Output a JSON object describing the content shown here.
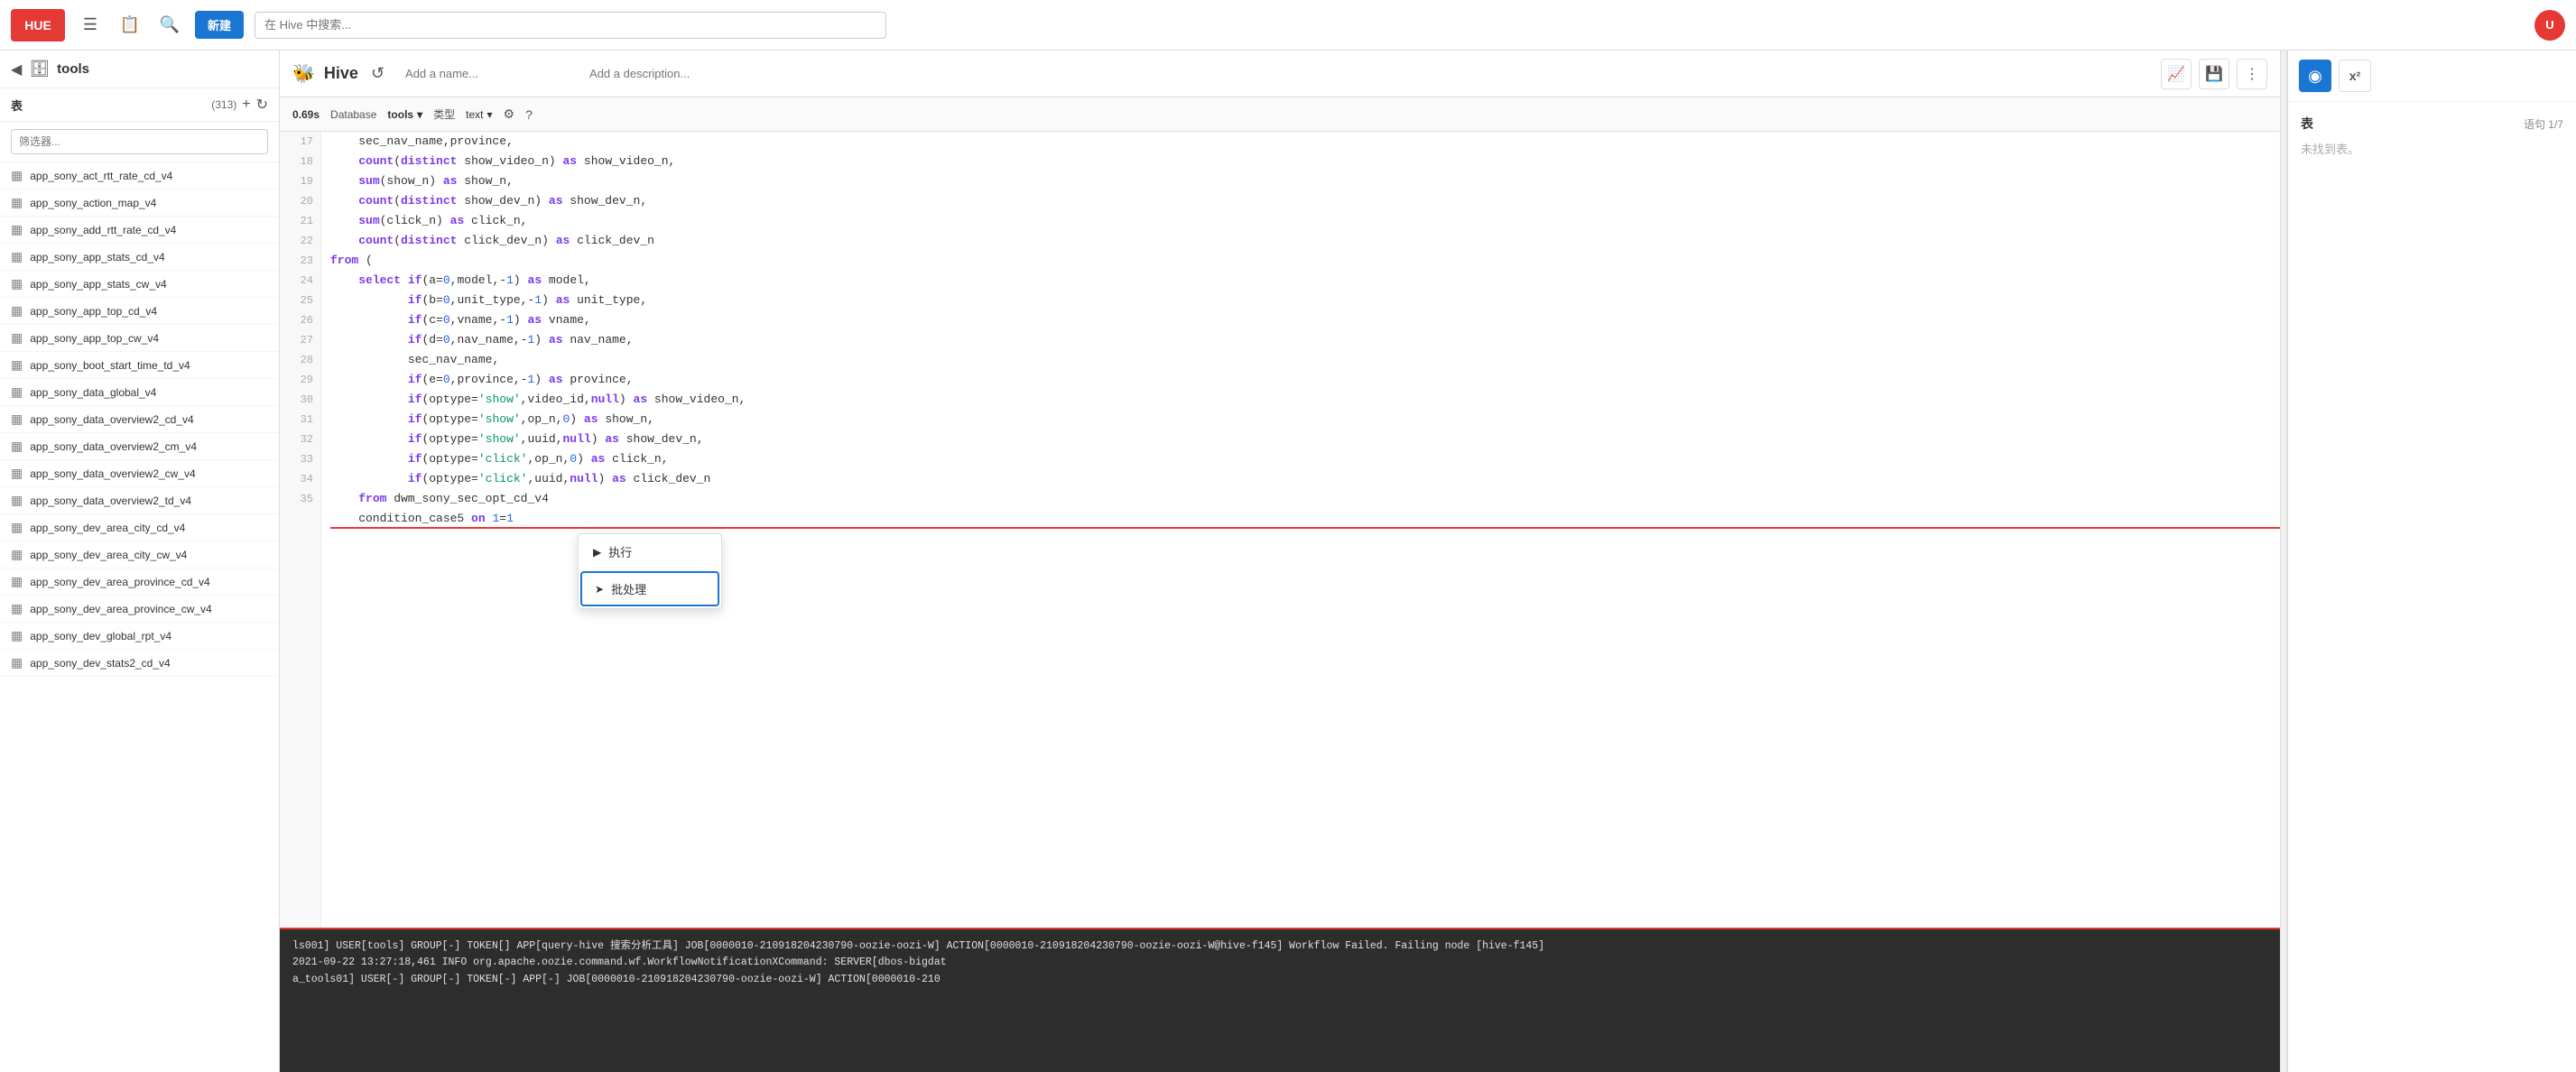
{
  "topbar": {
    "logo_text": "HUE",
    "new_button": "新建",
    "search_placeholder": "在 Hive 中搜索..."
  },
  "sidebar": {
    "back_label": "◀",
    "db_icon": "🗄",
    "title": "tools",
    "tables_label": "表",
    "count": "(313)",
    "add_icon": "+",
    "refresh_icon": "↻",
    "filter_placeholder": "筛选器...",
    "items": [
      {
        "label": "app_sony_act_rtt_rate_cd_v4"
      },
      {
        "label": "app_sony_action_map_v4"
      },
      {
        "label": "app_sony_add_rtt_rate_cd_v4"
      },
      {
        "label": "app_sony_app_stats_cd_v4"
      },
      {
        "label": "app_sony_app_stats_cw_v4"
      },
      {
        "label": "app_sony_app_top_cd_v4"
      },
      {
        "label": "app_sony_app_top_cw_v4"
      },
      {
        "label": "app_sony_boot_start_time_td_v4"
      },
      {
        "label": "app_sony_data_global_v4"
      },
      {
        "label": "app_sony_data_overview2_cd_v4"
      },
      {
        "label": "app_sony_data_overview2_cm_v4"
      },
      {
        "label": "app_sony_data_overview2_cw_v4"
      },
      {
        "label": "app_sony_data_overview2_td_v4"
      },
      {
        "label": "app_sony_dev_area_city_cd_v4"
      },
      {
        "label": "app_sony_dev_area_city_cw_v4"
      },
      {
        "label": "app_sony_dev_area_province_cd_v4"
      },
      {
        "label": "app_sony_dev_area_province_cw_v4"
      },
      {
        "label": "app_sony_dev_global_rpt_v4"
      },
      {
        "label": "app_sony_dev_stats2_cd_v4"
      }
    ]
  },
  "editor": {
    "hive_icon": "🐝",
    "hive_label": "Hive",
    "undo_icon": "↺",
    "name_placeholder": "Add a name...",
    "desc_placeholder": "Add a description...",
    "chart_icon": "📈",
    "save_icon": "💾",
    "more_icon": "⋮",
    "meta_time": "0.69s",
    "meta_db_label": "Database",
    "meta_db_value": "tools",
    "meta_db_arrow": "▾",
    "meta_type_label": "类型",
    "meta_type_value": "text",
    "meta_type_arrow": "▾",
    "meta_settings_icon": "⚙",
    "meta_help_icon": "?"
  },
  "code": {
    "lines": [
      {
        "num": 17,
        "content": "    sec_nav_name,province,",
        "selected": false
      },
      {
        "num": 18,
        "content": "    count(distinct show_video_n) as show_video_n,",
        "selected": false
      },
      {
        "num": 19,
        "content": "    sum(show_n) as show_n,",
        "selected": false
      },
      {
        "num": 20,
        "content": "    count(distinct show_dev_n) as show_dev_n,",
        "selected": false
      },
      {
        "num": 21,
        "content": "    sum(click_n) as click_n,",
        "selected": false
      },
      {
        "num": 22,
        "content": "    count(distinct click_dev_n) as click_dev_n",
        "selected": false
      },
      {
        "num": 23,
        "content": "from (",
        "selected": false
      },
      {
        "num": 24,
        "content": "    select if(a=0,model,-1) as model,",
        "selected": false
      },
      {
        "num": 25,
        "content": "           if(b=0,unit_type,-1) as unit_type,",
        "selected": false
      },
      {
        "num": 26,
        "content": "           if(c=0,vname,-1) as vname,",
        "selected": false
      },
      {
        "num": 27,
        "content": "           if(d=0,nav_name,-1) as nav_name,",
        "selected": false
      },
      {
        "num": 28,
        "content": "           sec_nav_name,",
        "selected": false
      },
      {
        "num": 29,
        "content": "           if(e=0,province,-1) as province,",
        "selected": false
      },
      {
        "num": 30,
        "content": "           if(optype='show',video_id,null) as show_video_n,",
        "selected": false
      },
      {
        "num": 31,
        "content": "           if(optype='show',op_n,0) as show_n,",
        "selected": false
      },
      {
        "num": 32,
        "content": "           if(optype='show',uuid,null) as show_dev_n,",
        "selected": false
      },
      {
        "num": 33,
        "content": "           if(optype='click',op_n,0) as click_n,",
        "selected": false
      },
      {
        "num": 34,
        "content": "           if(optype='click',uuid,null) as click_dev_n",
        "selected": false
      },
      {
        "num": 35,
        "content": "    from dwm_sony_sec_opt_cd_v4",
        "selected": false
      }
    ],
    "red_line": "    condition_case5 on 1=1"
  },
  "context_menu": {
    "execute_icon": "▶",
    "execute_label": "执行",
    "batch_icon": "➤",
    "batch_label": "批处理"
  },
  "log": {
    "lines": [
      "ls001] USER[tools] GROUP[-] TOKEN[] APP[query-hive 搜索分析工具] JOB[0000010-210918204230790-oozie-oozi-W] ACTION[0000010-210918204230790-oozie-oozi-W@hive-f145] Workflow Failed. Failing node [hive-f145]",
      "2021-09-22 13:27:18,461 INFO org.apache.oozie.command.wf.WorkflowNotificationXCommand: SERVER[dbos-bigdat",
      "a_tools01] USER[-] GROUP[-] TOKEN[-] APP[-] JOB[0000010-210918204230790-oozie-oozi-W] ACTION[0000010-210"
    ]
  },
  "right_panel": {
    "assist_icon": "◉",
    "x2_label": "x²",
    "title": "表",
    "pagination": "语句 1/7",
    "empty_text": "未找到表。"
  }
}
